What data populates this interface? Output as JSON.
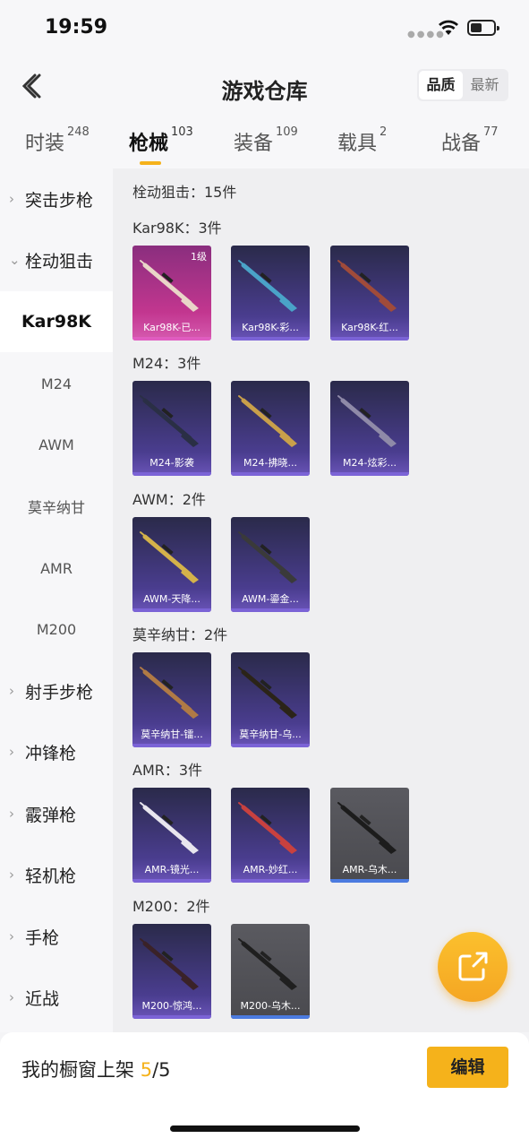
{
  "status": {
    "time": "19:59"
  },
  "header": {
    "title": "游戏仓库",
    "sort_quality": "品质",
    "sort_latest": "最新"
  },
  "tabs": [
    {
      "label": "时装",
      "count": "248"
    },
    {
      "label": "枪械",
      "count": "103"
    },
    {
      "label": "装备",
      "count": "109"
    },
    {
      "label": "载具",
      "count": "2"
    },
    {
      "label": "战备",
      "count": "77"
    }
  ],
  "sidebar": {
    "categories": [
      "突击步枪",
      "栓动狙击",
      "射手步枪",
      "冲锋枪",
      "霰弹枪",
      "轻机枪",
      "手枪",
      "近战"
    ],
    "subitems": [
      "Kar98K",
      "M24",
      "AWM",
      "莫辛纳甘",
      "AMR",
      "M200"
    ]
  },
  "content": {
    "section_title": "栓动狙击：15件",
    "groups": [
      {
        "title": "Kar98K：3件",
        "items": [
          {
            "name": "Kar98K-已...",
            "level": "1级"
          },
          {
            "name": "Kar98K-彩..."
          },
          {
            "name": "Kar98K-红..."
          }
        ]
      },
      {
        "title": "M24：3件",
        "items": [
          {
            "name": "M24-影袭"
          },
          {
            "name": "M24-拂晓..."
          },
          {
            "name": "M24-炫彩..."
          }
        ]
      },
      {
        "title": "AWM：2件",
        "items": [
          {
            "name": "AWM-天降..."
          },
          {
            "name": "AWM-鎏金..."
          }
        ]
      },
      {
        "title": "莫辛纳甘：2件",
        "items": [
          {
            "name": "莫辛纳甘-镭..."
          },
          {
            "name": "莫辛纳甘-乌..."
          }
        ]
      },
      {
        "title": "AMR：3件",
        "items": [
          {
            "name": "AMR-镜光..."
          },
          {
            "name": "AMR-妙红..."
          },
          {
            "name": "AMR-乌木..."
          }
        ]
      },
      {
        "title": "M200：2件",
        "items": [
          {
            "name": "M200-惊鸿..."
          },
          {
            "name": "M200-乌木..."
          }
        ]
      }
    ]
  },
  "bottom": {
    "label": "我的橱窗上架",
    "count": "5",
    "total": "/5",
    "edit": "编辑"
  },
  "colors": {
    "accent": "#f5b21b",
    "pink": "#c2368f",
    "purple": "#4a3d8f",
    "gray": "#4a4a4f",
    "blue_bar": "#4b7be0"
  }
}
